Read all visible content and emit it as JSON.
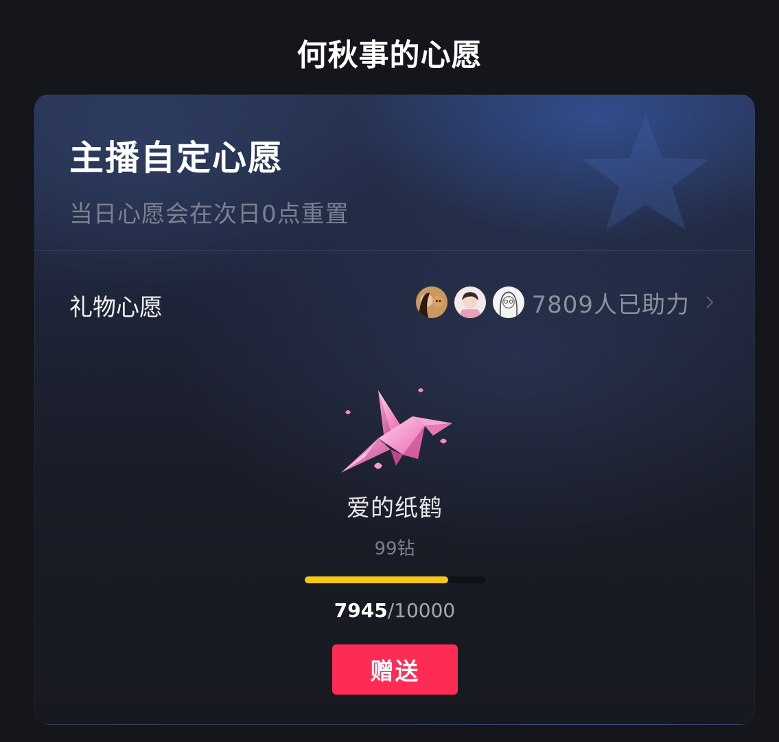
{
  "page": {
    "title": "何秋事的心愿"
  },
  "card": {
    "title": "主播自定心愿",
    "subtitle": "当日心愿会在次日0点重置"
  },
  "gift_wish": {
    "label": "礼物心愿",
    "helpers_text": "7809人已助力",
    "chevron_icon": "chevron-right-icon",
    "avatars": [
      "avatar-1",
      "avatar-2",
      "avatar-3"
    ]
  },
  "gift": {
    "name": "爱的纸鹤",
    "price": "99钻",
    "image_icon": "paper-crane-icon",
    "progress": {
      "current": "7945",
      "separator": "/",
      "total": "10000",
      "fraction": 0.7945,
      "color": "#f5c518"
    },
    "send_label": "赠送",
    "send_color": "#fe2c55"
  }
}
